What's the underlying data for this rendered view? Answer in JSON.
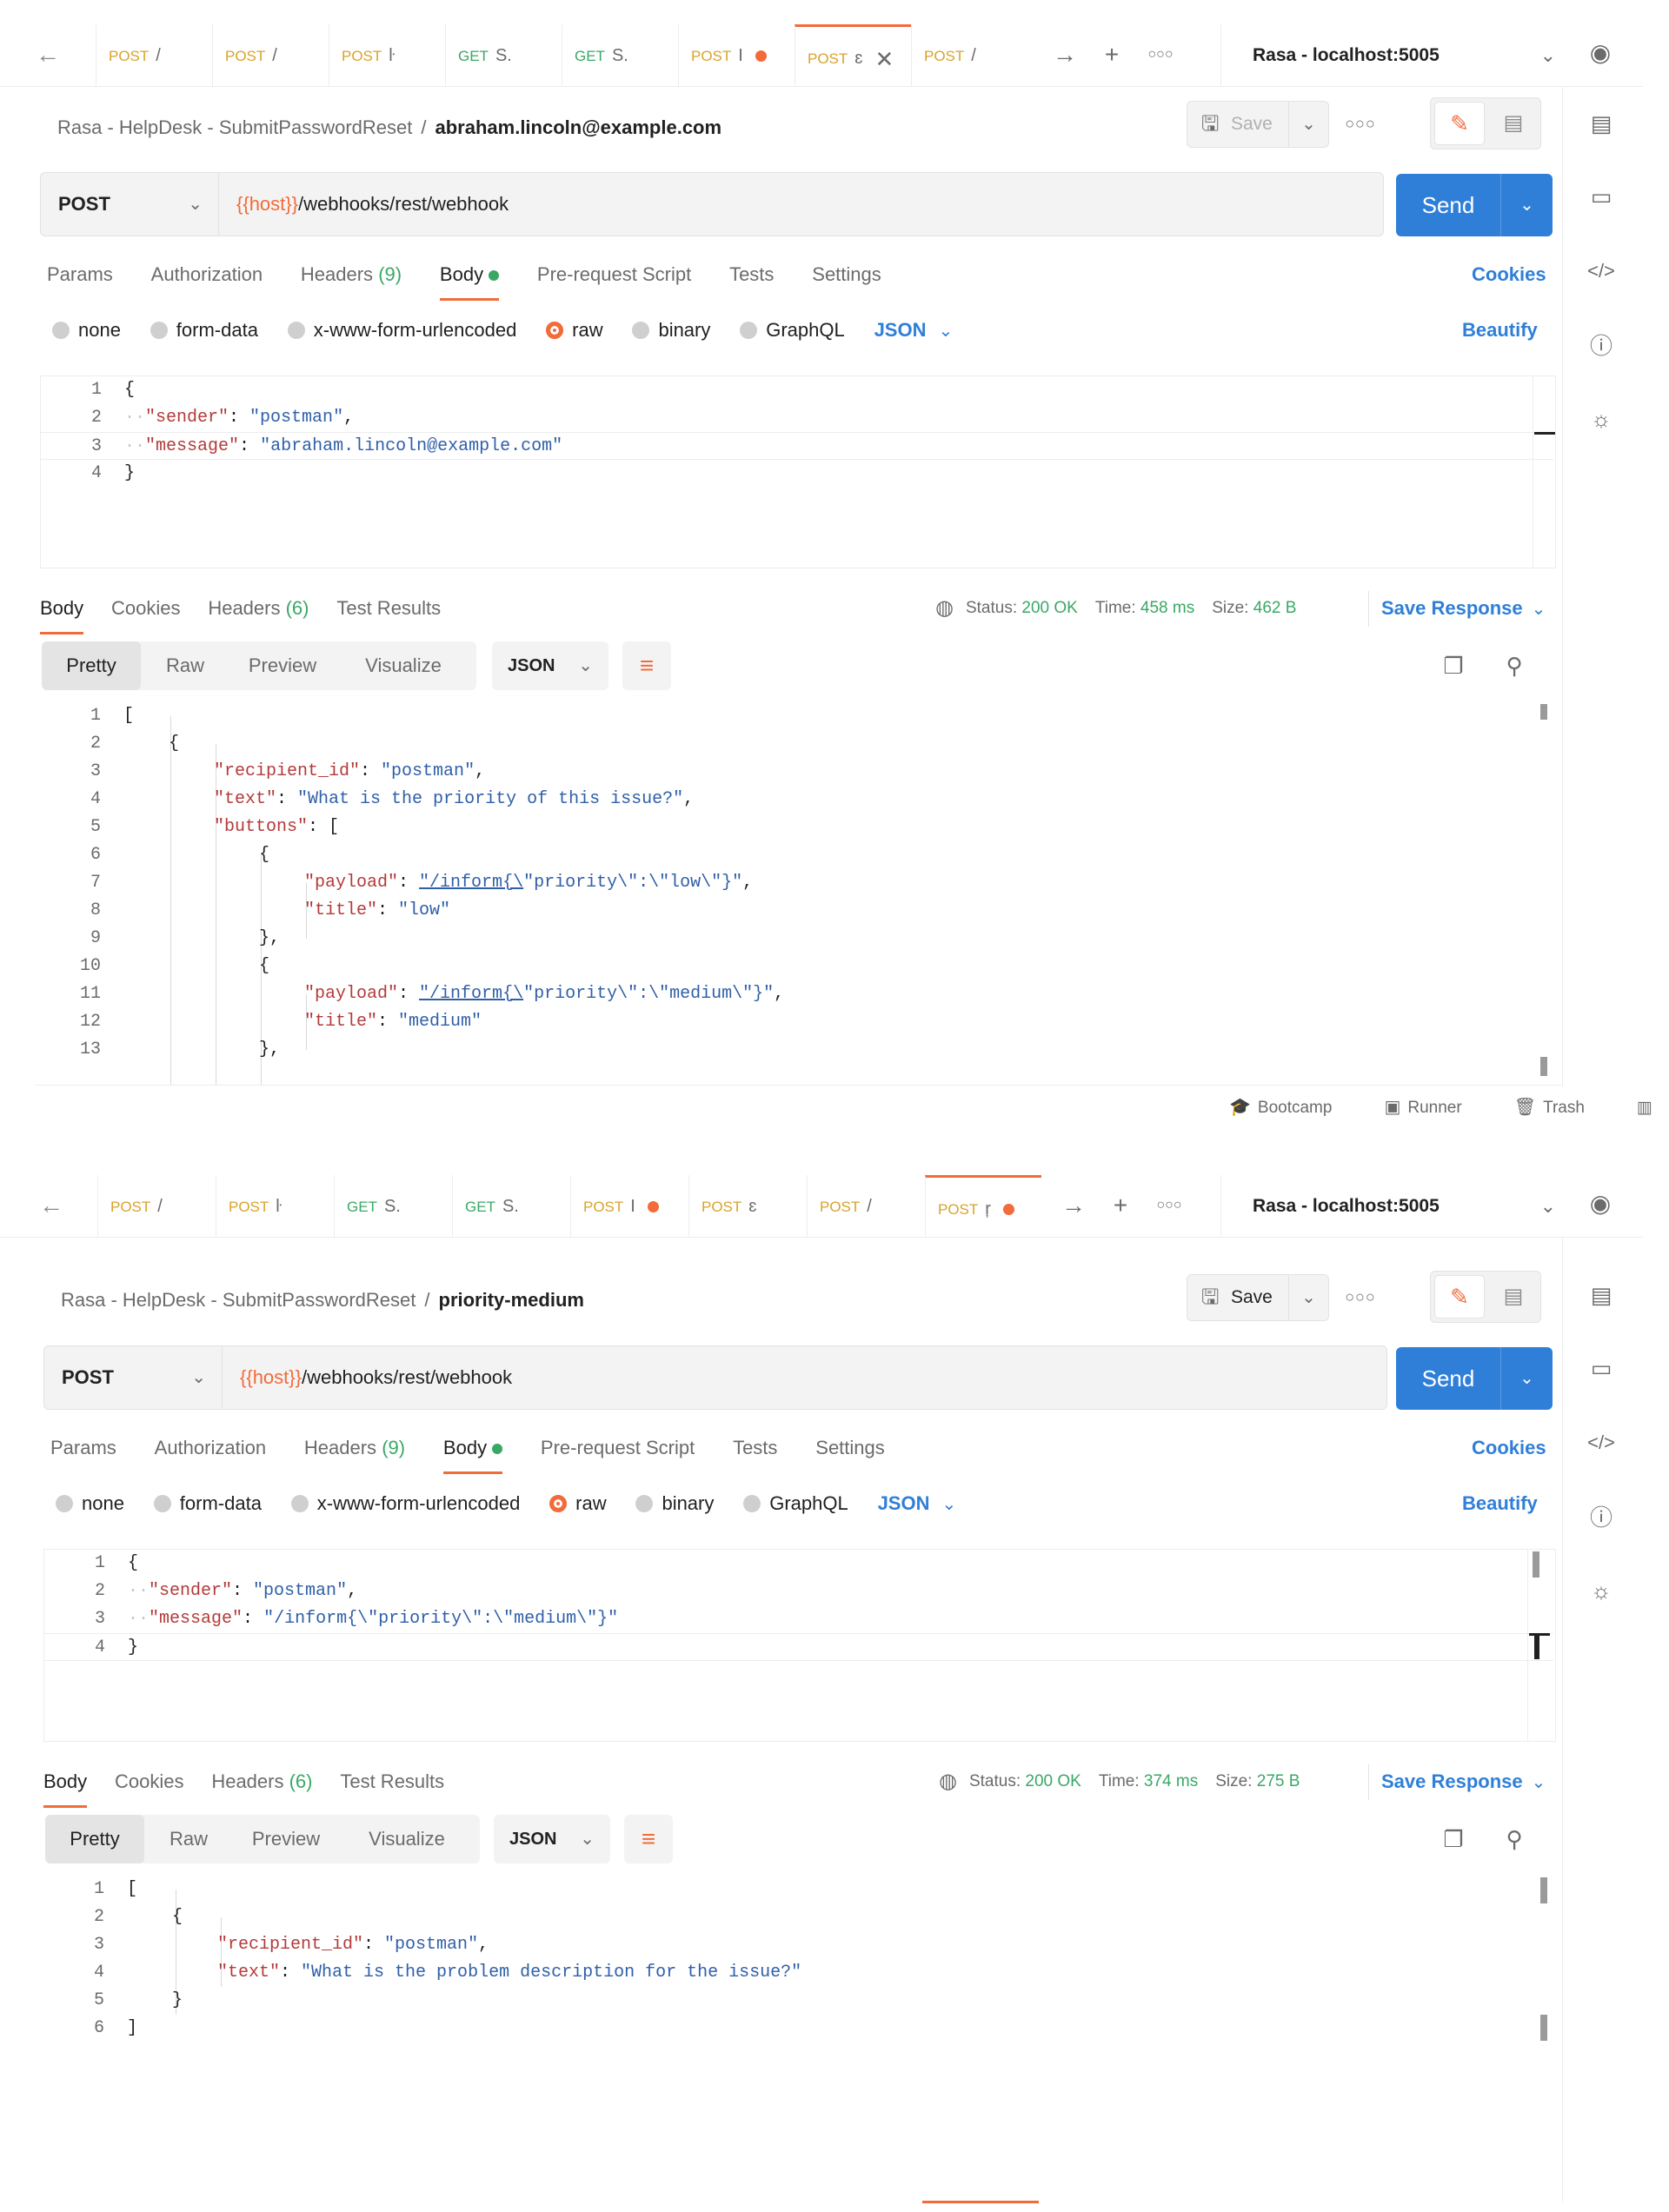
{
  "pane1": {
    "tabs": [
      {
        "method": "POST",
        "name": "/"
      },
      {
        "method": "POST",
        "name": "/"
      },
      {
        "method": "POST",
        "name": "ŀ"
      },
      {
        "method": "GET",
        "name": "S."
      },
      {
        "method": "GET",
        "name": "S."
      },
      {
        "method": "POST",
        "name": "I"
      },
      {
        "method": "POST",
        "name": "ɛ"
      },
      {
        "method": "POST",
        "name": "/"
      }
    ],
    "environment": "Rasa - localhost:5005",
    "breadcrumb": {
      "collection": "Rasa - HelpDesk - SubmitPasswordReset",
      "separator": "/",
      "request": "abraham.lincoln@example.com"
    },
    "save_label": "Save",
    "request": {
      "method": "POST",
      "url_var": "{{host}}",
      "url_path": "/webhooks/rest/webhook"
    },
    "send_label": "Send",
    "req_tabs": {
      "params": "Params",
      "auth": "Authorization",
      "headers": "Headers",
      "headers_count": "(9)",
      "body": "Body",
      "prereq": "Pre-request Script",
      "tests": "Tests",
      "settings": "Settings"
    },
    "cookies_label": "Cookies",
    "body_types": {
      "none": "none",
      "form_data": "form-data",
      "urlencoded": "x-www-form-urlencoded",
      "raw": "raw",
      "binary": "binary",
      "graphql": "GraphQL",
      "json": "JSON"
    },
    "beautify_label": "Beautify",
    "request_body": {
      "l1": "{",
      "l2_key": "\"sender\"",
      "l2_val": "\"postman\"",
      "l3_key": "\"message\"",
      "l3_val": "\"abraham.lincoln@example.com\"",
      "l4": "}"
    },
    "resp_tabs": {
      "body": "Body",
      "cookies": "Cookies",
      "headers": "Headers",
      "headers_count": "(6)",
      "tests": "Test Results"
    },
    "status": {
      "status_label": "Status:",
      "status_value": "200 OK",
      "time_label": "Time:",
      "time_value": "458 ms",
      "size_label": "Size:",
      "size_value": "462 B"
    },
    "save_response": "Save Response",
    "views": {
      "pretty": "Pretty",
      "raw": "Raw",
      "preview": "Preview",
      "visualize": "Visualize"
    },
    "format": "JSON",
    "response_body": {
      "l1": "[",
      "l2": "{",
      "l3_key": "\"recipient_id\"",
      "l3_val": "\"postman\"",
      "l4_key": "\"text\"",
      "l4_val": "\"What is the priority of this issue?\"",
      "l5_key": "\"buttons\"",
      "l5_rest": "[",
      "l6": "{",
      "l7_key": "\"payload\"",
      "l7_link": "\"/inform{\\",
      "l7_rest": "\"priority\\\":\\\"low\\\"}\"",
      "l8_key": "\"title\"",
      "l8_val": "\"low\"",
      "l9": "},",
      "l10": "{",
      "l11_key": "\"payload\"",
      "l11_link": "\"/inform{\\",
      "l11_rest": "\"priority\\\":\\\"medium\\\"}\"",
      "l12_key": "\"title\"",
      "l12_val": "\"medium\"",
      "l13": "},"
    },
    "statusbar": {
      "bootcamp": "Bootcamp",
      "runner": "Runner",
      "trash": "Trash"
    }
  },
  "pane2": {
    "tabs": [
      {
        "method": "POST",
        "name": "/"
      },
      {
        "method": "POST",
        "name": "ŀ"
      },
      {
        "method": "GET",
        "name": "S."
      },
      {
        "method": "GET",
        "name": "S."
      },
      {
        "method": "POST",
        "name": "I"
      },
      {
        "method": "POST",
        "name": "ɛ"
      },
      {
        "method": "POST",
        "name": "/"
      },
      {
        "method": "POST",
        "name": "ŗ"
      }
    ],
    "environment": "Rasa - localhost:5005",
    "breadcrumb": {
      "collection": "Rasa - HelpDesk - SubmitPasswordReset",
      "separator": "/",
      "request": "priority-medium"
    },
    "save_label": "Save",
    "request": {
      "method": "POST",
      "url_var": "{{host}}",
      "url_path": "/webhooks/rest/webhook"
    },
    "send_label": "Send",
    "req_tabs": {
      "params": "Params",
      "auth": "Authorization",
      "headers": "Headers",
      "headers_count": "(9)",
      "body": "Body",
      "prereq": "Pre-request Script",
      "tests": "Tests",
      "settings": "Settings"
    },
    "cookies_label": "Cookies",
    "body_types": {
      "none": "none",
      "form_data": "form-data",
      "urlencoded": "x-www-form-urlencoded",
      "raw": "raw",
      "binary": "binary",
      "graphql": "GraphQL",
      "json": "JSON"
    },
    "beautify_label": "Beautify",
    "request_body": {
      "l1": "{",
      "l2_key": "\"sender\"",
      "l2_val": "\"postman\"",
      "l3_key": "\"message\"",
      "l3_val": "\"/inform{\\\"priority\\\":\\\"medium\\\"}\"",
      "l4": "}"
    },
    "resp_tabs": {
      "body": "Body",
      "cookies": "Cookies",
      "headers": "Headers",
      "headers_count": "(6)",
      "tests": "Test Results"
    },
    "status": {
      "status_label": "Status:",
      "status_value": "200 OK",
      "time_label": "Time:",
      "time_value": "374 ms",
      "size_label": "Size:",
      "size_value": "275 B"
    },
    "save_response": "Save Response",
    "views": {
      "pretty": "Pretty",
      "raw": "Raw",
      "preview": "Preview",
      "visualize": "Visualize"
    },
    "format": "JSON",
    "response_body": {
      "l1": "[",
      "l2": "{",
      "l3_key": "\"recipient_id\"",
      "l3_val": "\"postman\"",
      "l4_key": "\"text\"",
      "l4_val": "\"What is the problem description for the issue?\"",
      "l5": "}",
      "l6": "]"
    }
  },
  "icons": {
    "back": "arrow-left-icon",
    "forward": "arrow-right-icon",
    "new_tab": "plus-icon",
    "more": "ellipsis-icon",
    "eye": "eye-icon",
    "doc": "document-icon",
    "comment": "comment-icon",
    "code": "code-icon",
    "info": "info-icon",
    "bulb": "lightbulb-icon",
    "copy": "copy-icon",
    "search": "search-icon",
    "globe": "globe-icon",
    "wrap": "wrap-lines-icon"
  },
  "colors": {
    "accent": "#f26b3a",
    "send": "#2f7fd8",
    "post": "#d9a32a",
    "get": "#3aa865"
  }
}
